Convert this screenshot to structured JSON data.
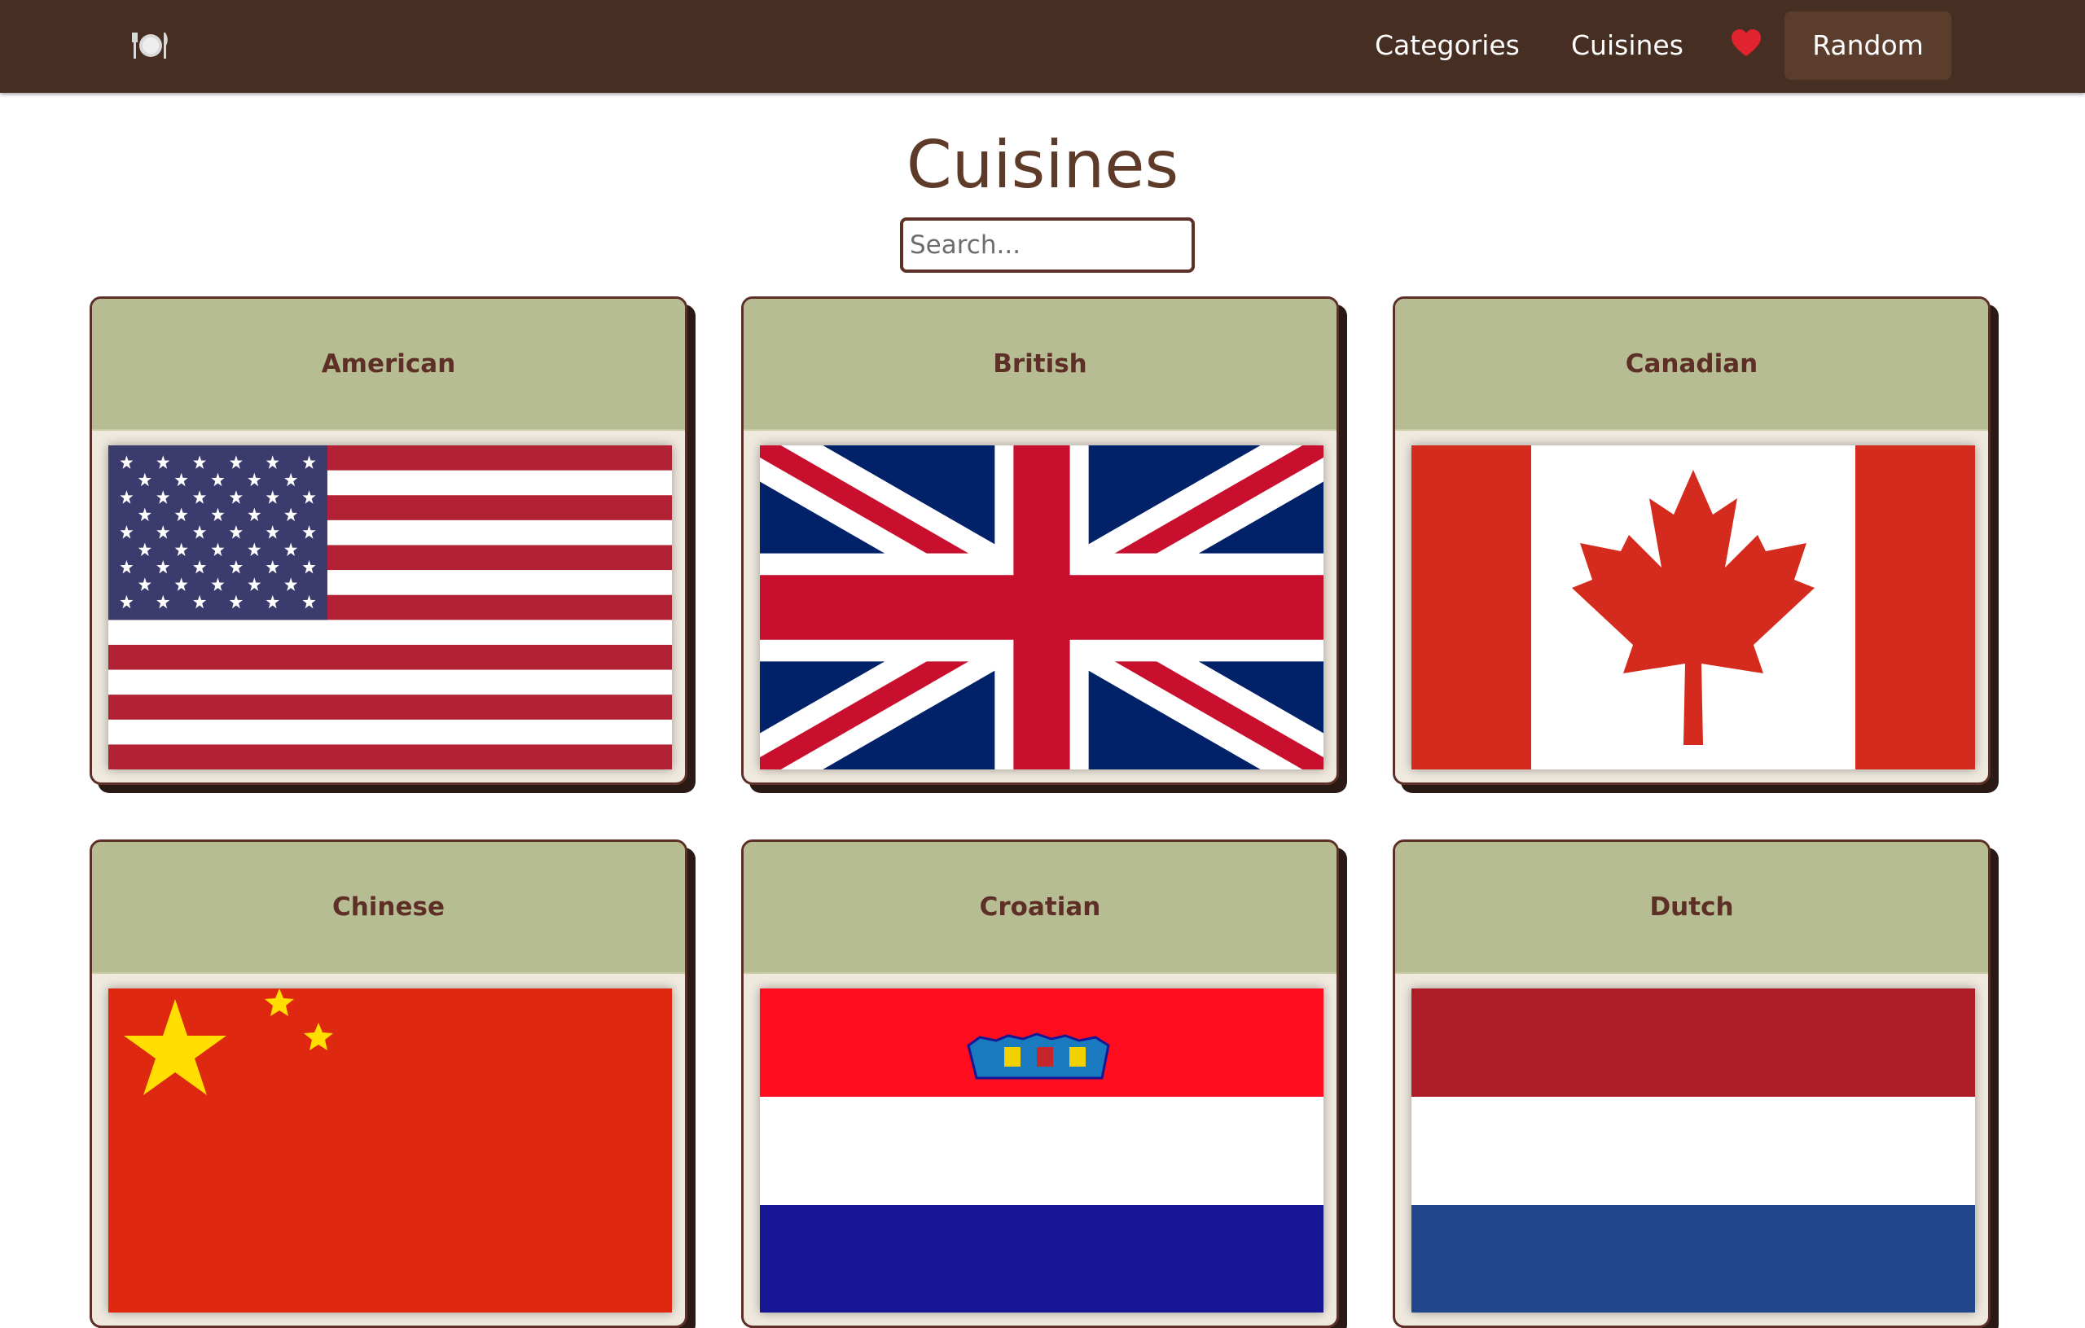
{
  "nav": {
    "logo_icon": "plate-cutlery-icon",
    "links": [
      {
        "label": "Categories"
      },
      {
        "label": "Cuisines"
      }
    ],
    "favorites_icon": "heart-icon",
    "random_label": "Random"
  },
  "page": {
    "title": "Cuisines",
    "search_placeholder": "Search..."
  },
  "cuisines": [
    {
      "name": "American",
      "flag_icon": "usa-flag-icon"
    },
    {
      "name": "British",
      "flag_icon": "uk-flag-icon"
    },
    {
      "name": "Canadian",
      "flag_icon": "canada-flag-icon"
    },
    {
      "name": "Chinese",
      "flag_icon": "china-flag-icon"
    },
    {
      "name": "Croatian",
      "flag_icon": "croatia-flag-icon"
    },
    {
      "name": "Dutch",
      "flag_icon": "netherlands-flag-icon"
    }
  ],
  "colors": {
    "navbar": "#472e22",
    "random_button": "#5b3d2d",
    "card_header": "#b6bd92",
    "card_border": "#5e2f26",
    "title": "#5e3b28"
  }
}
